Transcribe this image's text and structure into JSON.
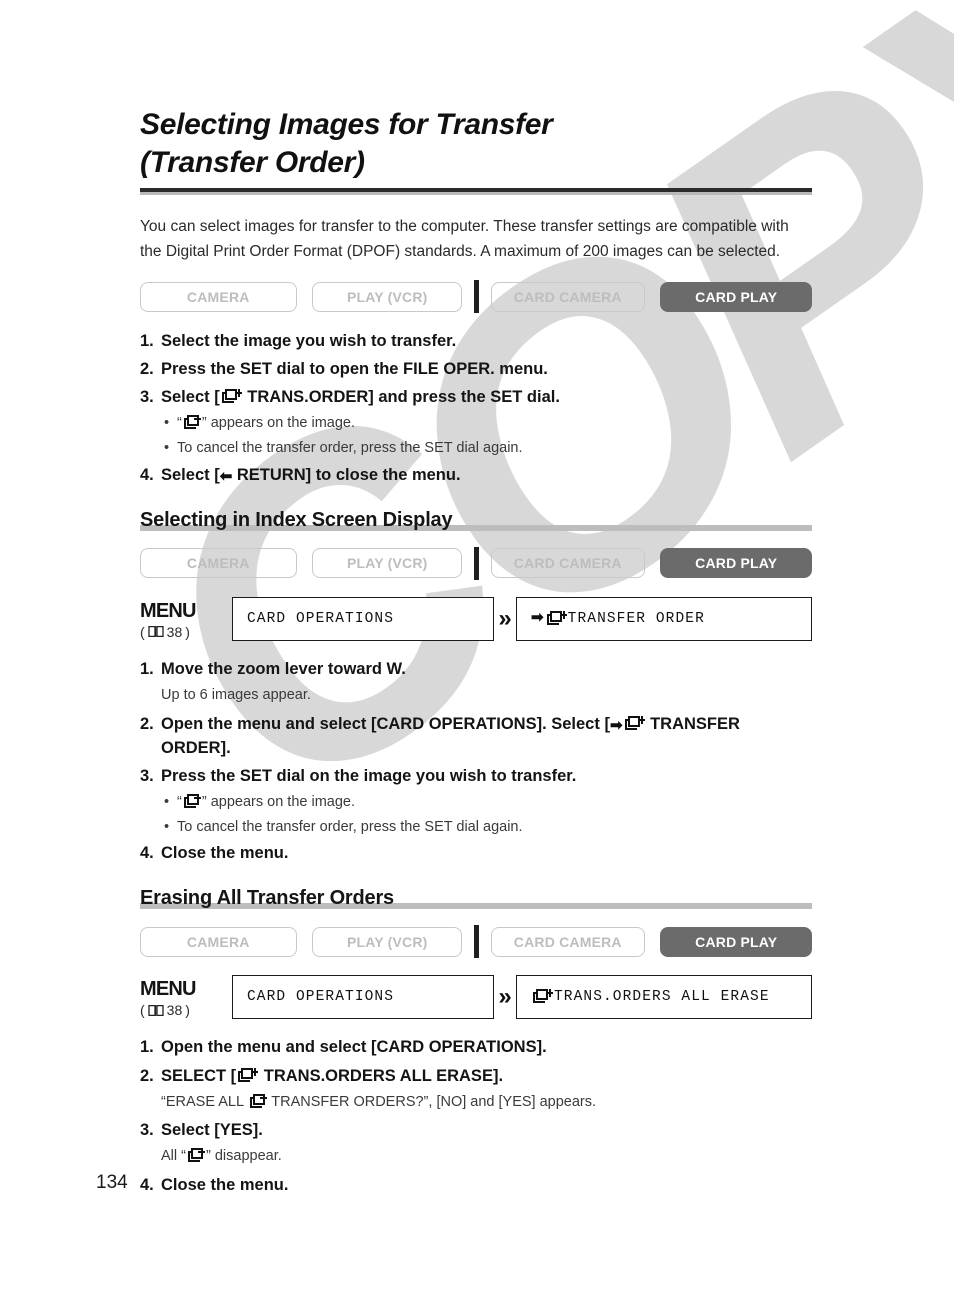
{
  "page": {
    "number": "134",
    "watermark": "COPY",
    "watermark_color": "#d8d8d8"
  },
  "title": {
    "line1": "Selecting Images for Transfer",
    "line2": "(Transfer Order)"
  },
  "intro": "You can select images for transfer to the computer. These transfer settings are compatible with the Digital Print Order Format (DPOF) standards. A maximum of 200 images can be selected.",
  "modes": {
    "items": [
      {
        "label": "CAMERA",
        "active": false
      },
      {
        "label": "PLAY (VCR)",
        "active": false
      },
      {
        "label": "CARD CAMERA",
        "active": false
      },
      {
        "label": "CARD PLAY",
        "active": true
      }
    ],
    "active_bg": "#6b6b6b",
    "inactive_border": "#c9c9c9",
    "inactive_text": "#bdbdbd"
  },
  "section1": {
    "steps": [
      {
        "num": "1.",
        "pre": "Select the image you wish to transfer.",
        "icon": null,
        "post": ""
      },
      {
        "num": "2.",
        "pre": "Press the SET dial to open the FILE OPER. menu.",
        "icon": null,
        "post": ""
      },
      {
        "num": "3.",
        "pre": "Select [",
        "icon": "transfer-order-icon",
        "post": " TRANS.ORDER] and press the SET dial."
      },
      {
        "num": "4.",
        "pre": "Select [",
        "icon": "arrow-left-icon",
        "post": " RETURN] to close the menu."
      }
    ],
    "bullet1_pre": "“",
    "bullet1_post": "” appears on the image.",
    "bullet2": "To cancel the transfer order, press the SET dial again."
  },
  "section2": {
    "heading": "Selecting in Index Screen Display",
    "menu": {
      "label": "MENU",
      "ref_prefix": "(",
      "ref_page": "38",
      "ref_suffix": ")",
      "box1": "CARD OPERATIONS",
      "chevron": "»",
      "box2_arrow": "➡",
      "box2_text": "TRANSFER ORDER"
    },
    "steps": {
      "s1_num": "1.",
      "s1_text": "Move the zoom lever toward W.",
      "s1_note": "Up to 6 images appear.",
      "s2_num": "2.",
      "s2_pre": "Open the menu and select [CARD OPERATIONS]. Select [",
      "s2_arrow": "➡",
      "s2_post": " TRANSFER ORDER].",
      "s3_num": "3.",
      "s3_text": "Press the SET dial on the image you wish to transfer.",
      "s3_b1_pre": "“",
      "s3_b1_post": "” appears on the image.",
      "s3_b2": "To cancel the transfer order, press the SET dial again.",
      "s4_num": "4.",
      "s4_text": "Close the menu."
    }
  },
  "section3": {
    "heading": "Erasing All Transfer Orders",
    "menu": {
      "label": "MENU",
      "ref_prefix": "(",
      "ref_page": "38",
      "ref_suffix": ")",
      "box1": "CARD OPERATIONS",
      "chevron": "»",
      "box2_text": "TRANS.ORDERS ALL ERASE"
    },
    "steps": {
      "s1_num": "1.",
      "s1_text": "Open the menu and select [CARD OPERATIONS].",
      "s2_num": "2.",
      "s2_pre": "SELECT [",
      "s2_post": " TRANS.ORDERS ALL ERASE].",
      "s2_note_pre": "“ERASE ALL ",
      "s2_note_post": " TRANSFER ORDERS?”, [NO] and [YES] appears.",
      "s3_num": "3.",
      "s3_text": "Select [YES].",
      "s3_note_pre": "All “",
      "s3_note_post": "” disappear.",
      "s4_num": "4.",
      "s4_text": "Close the menu."
    }
  }
}
